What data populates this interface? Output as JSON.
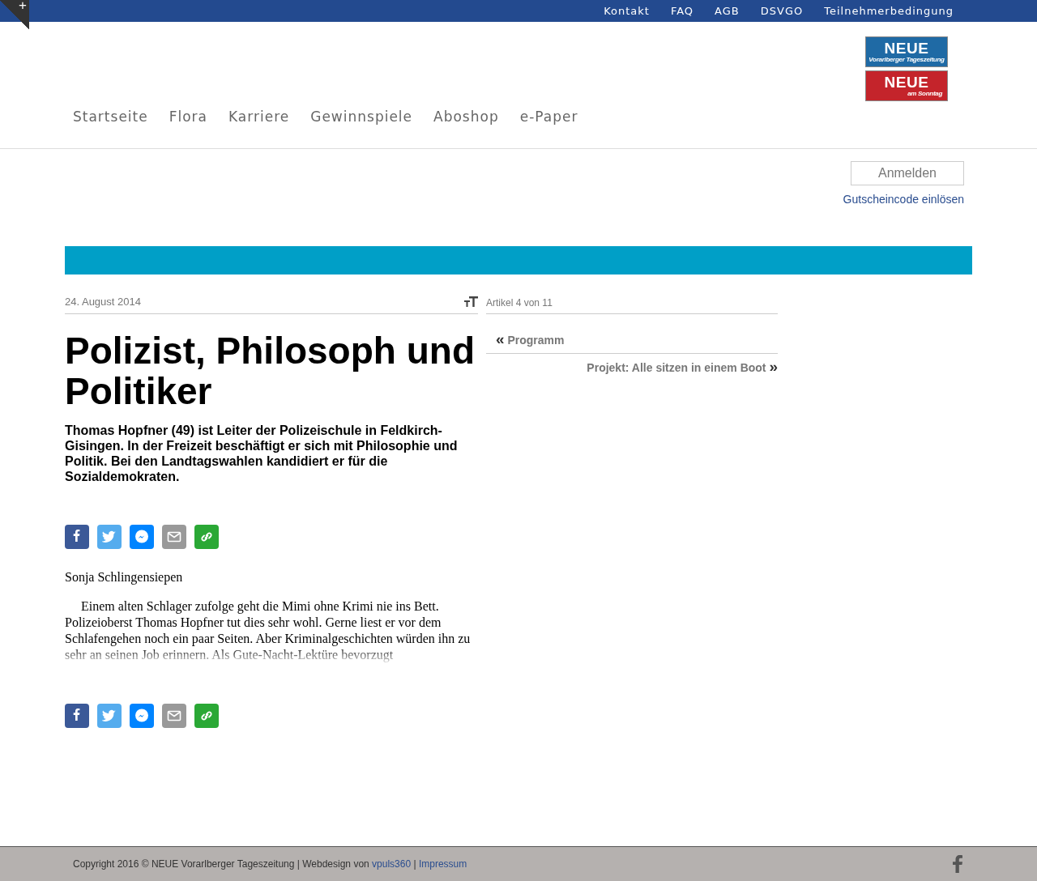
{
  "corner_toggle": "+",
  "top_links": [
    "Kontakt",
    "FAQ",
    "AGB",
    "DSVGO",
    "Teilnehmerbedingung"
  ],
  "logos": [
    {
      "name": "NEUE",
      "tagline": "Vorarlberger Tageszeitung",
      "color": "#1f6aa5"
    },
    {
      "name": "NEUE",
      "tagline": "am Sonntag",
      "color": "#c4242b"
    }
  ],
  "main_nav": [
    "Startseite",
    "Flora",
    "Karriere",
    "Gewinnspiele",
    "Aboshop",
    "e-Paper"
  ],
  "login": {
    "button": "Anmelden",
    "voucher_link": "Gutscheincode einlösen"
  },
  "article": {
    "date": "24. August 2014",
    "title": "Polizist, Philosoph und Politiker",
    "lead": "Thomas Hopfner (49) ist Leiter der Polizeischule in Feldkirch-Gisingen. In der Freizeit beschäftigt er sich mit Philosophie und Politik. Bei den Landtagswahlen kandidiert er für die Sozialdemokraten.",
    "author": "Sonja Schlingensiepen",
    "body": "Einem alten Schlager zufolge geht die Mimi ohne Krimi nie ins Bett. Polizeioberst Thomas Hopfner tut dies sehr wohl. Gerne liest er vor dem Schlafengehen noch ein paar Seiten. Aber Kriminalgeschichten würden ihn zu sehr an seinen Job erinnern. Als Gute-Nacht-Lektüre bevorzugt"
  },
  "share_buttons": [
    {
      "kind": "facebook"
    },
    {
      "kind": "twitter"
    },
    {
      "kind": "messenger"
    },
    {
      "kind": "email"
    },
    {
      "kind": "link"
    }
  ],
  "article_nav": {
    "counter": "Artikel 4 von 11",
    "previous": {
      "arrow": "«",
      "label": "Programm"
    },
    "next": {
      "label": "Projekt: Alle sitzen in einem Boot",
      "arrow": "»"
    }
  },
  "footer": {
    "text": "Copyright 2016 © NEUE Vorarlberger Tageszeitung | Webdesign von ",
    "links": [
      {
        "label": "vpuls360",
        "separator": " | "
      },
      {
        "label": "Impressum"
      }
    ]
  }
}
